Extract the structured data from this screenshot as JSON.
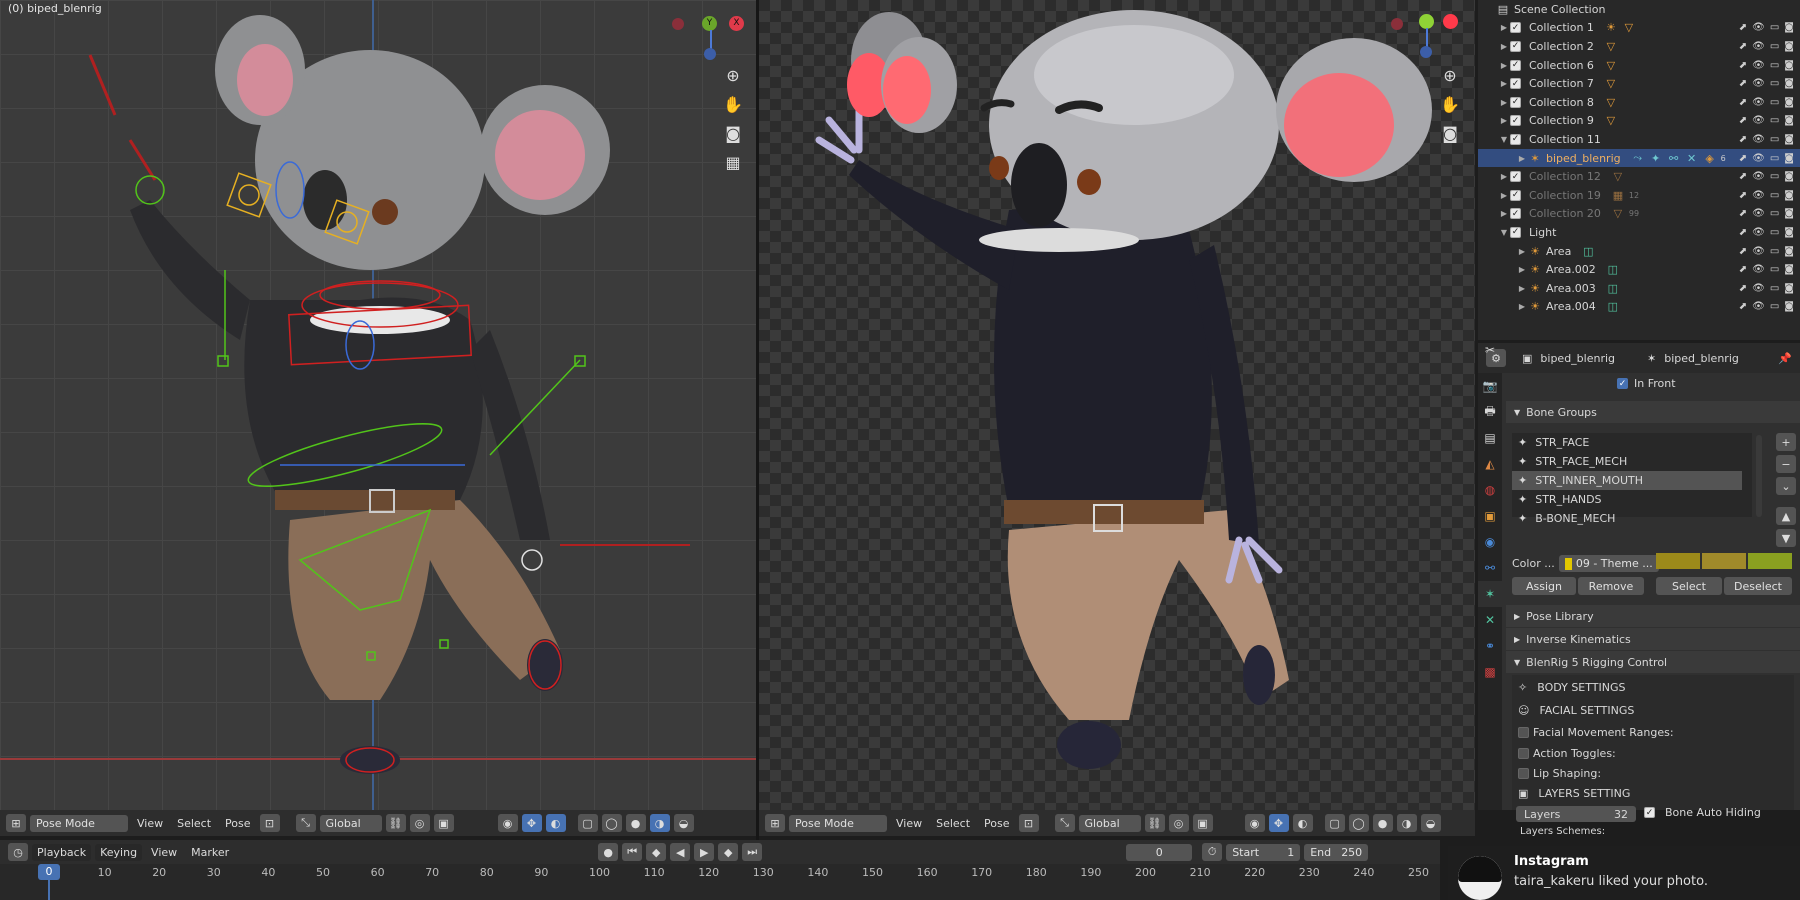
{
  "viewport_left": {
    "title": "(0) biped_blenrig",
    "mode": "Pose Mode",
    "menus": [
      "View",
      "Select",
      "Pose"
    ],
    "orientation": "Global"
  },
  "viewport_right": {
    "mode": "Pose Mode",
    "menus": [
      "View",
      "Select",
      "Pose"
    ],
    "orientation": "Global"
  },
  "gizmo": {
    "y": "Y",
    "x": "X"
  },
  "outliner": {
    "root": "Scene Collection",
    "rows": [
      {
        "label": "Collection 1",
        "dim": false,
        "indent": 1
      },
      {
        "label": "Collection 2",
        "dim": false,
        "indent": 1
      },
      {
        "label": "Collection 6",
        "dim": false,
        "indent": 1
      },
      {
        "label": "Collection 7",
        "dim": false,
        "indent": 1
      },
      {
        "label": "Collection 8",
        "dim": false,
        "indent": 1
      },
      {
        "label": "Collection 9",
        "dim": false,
        "indent": 1
      },
      {
        "label": "Collection 11",
        "dim": false,
        "indent": 1
      },
      {
        "label": "biped_blenrig",
        "dim": false,
        "indent": 2,
        "selected": true
      },
      {
        "label": "Collection 12",
        "dim": true,
        "indent": 1
      },
      {
        "label": "Collection 19",
        "dim": true,
        "indent": 1,
        "badge": "12"
      },
      {
        "label": "Collection 20",
        "dim": true,
        "indent": 1,
        "badge": "99"
      },
      {
        "label": "Light",
        "dim": false,
        "indent": 1
      },
      {
        "label": "Area",
        "dim": false,
        "indent": 2
      },
      {
        "label": "Area.002",
        "dim": false,
        "indent": 2
      },
      {
        "label": "Area.003",
        "dim": false,
        "indent": 2
      },
      {
        "label": "Area.004",
        "dim": false,
        "indent": 2
      }
    ],
    "bone_badge": "6"
  },
  "properties": {
    "object_name": "biped_blenrig",
    "data_name": "biped_blenrig",
    "in_front": "In Front",
    "bone_groups_title": "Bone Groups",
    "bone_groups": [
      "STR_FACE",
      "STR_FACE_MECH",
      "STR_INNER_MOUTH",
      "STR_HANDS",
      "B-BONE_MECH"
    ],
    "selected_group": 2,
    "color_label": "Color ...",
    "color_set": "09 - Theme ...",
    "assign": "Assign",
    "remove": "Remove",
    "select": "Select",
    "deselect": "Deselect",
    "pose_library": "Pose Library",
    "inverse_kinematics": "Inverse Kinematics",
    "blenrig_title": "BlenRig 5 Rigging Control",
    "body_settings": "BODY SETTINGS",
    "facial_settings": "FACIAL SETTINGS",
    "facial_ranges": "Facial Movement Ranges:",
    "action_toggles": "Action Toggles:",
    "lip_shaping": "Lip Shaping:",
    "layers_setting": "LAYERS SETTING",
    "layers": "Layers",
    "layers_value": "32",
    "bone_auto_hiding": "Bone Auto Hiding",
    "layers_schemes": "Layers Schemes:"
  },
  "timeline": {
    "menus": [
      "Playback",
      "Keying",
      "View",
      "Marker"
    ],
    "current_frame": "0",
    "start_label": "Start",
    "start": "1",
    "end_label": "End",
    "end": "250",
    "ticks": [
      "0",
      "10",
      "20",
      "30",
      "40",
      "50",
      "60",
      "70",
      "80",
      "90",
      "100",
      "110",
      "120",
      "130",
      "140",
      "150",
      "160",
      "170",
      "180",
      "190",
      "200",
      "210",
      "220",
      "230",
      "240",
      "250"
    ]
  },
  "notification": {
    "app": "Instagram",
    "message": "taira_kakeru liked your photo."
  }
}
